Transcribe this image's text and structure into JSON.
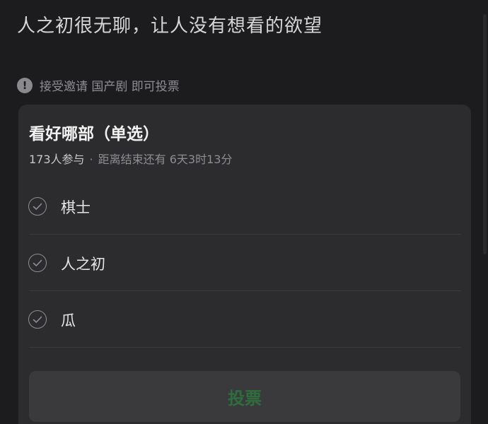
{
  "post": {
    "text": "人之初很无聊，让人没有想看的欲望"
  },
  "notice": {
    "icon": "exclamation-circle-icon",
    "text": "接受邀请 国产剧 即可投票"
  },
  "poll": {
    "title": "看好哪部（单选）",
    "participants": "173人参与",
    "separator": "·",
    "deadline": "距离结束还有 6天3时13分",
    "options": [
      {
        "label": "棋士",
        "icon": "check-circle-icon"
      },
      {
        "label": "人之初",
        "icon": "check-circle-icon"
      },
      {
        "label": "瓜",
        "icon": "check-circle-icon"
      }
    ],
    "vote_label": "投票"
  },
  "colors": {
    "background": "#1c1c1e",
    "card": "#2c2c2e",
    "vote_text": "#2f6d3d"
  }
}
